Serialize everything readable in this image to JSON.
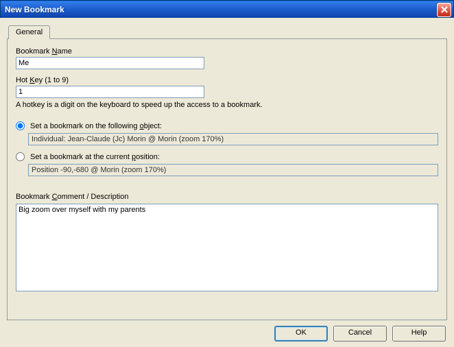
{
  "window": {
    "title": "New Bookmark"
  },
  "tabs": {
    "general": "General"
  },
  "bookmarkName": {
    "label_pre": "Bookmark ",
    "label_u": "N",
    "label_post": "ame",
    "value": "Me"
  },
  "hotKey": {
    "label_pre": "Hot ",
    "label_u": "K",
    "label_post": "ey  (1 to 9)",
    "value": "1",
    "hint": "A hotkey is a digit on the keyboard to speed up the access to a bookmark."
  },
  "radios": {
    "object": {
      "label_pre": "Set a bookmark on the following ",
      "label_u": "o",
      "label_post": "bject:",
      "value": "Individual: Jean-Claude (Jc) Morin @ Morin (zoom 170%)",
      "checked": true
    },
    "position": {
      "label_pre": "Set a bookmark at the current ",
      "label_u": "p",
      "label_post": "osition:",
      "value": "Position -90,-680 @ Morin (zoom 170%)",
      "checked": false
    }
  },
  "comment": {
    "label_pre": "Bookmark ",
    "label_u": "C",
    "label_post": "omment / Description",
    "value": "Big zoom over myself with my parents"
  },
  "buttons": {
    "ok": "OK",
    "cancel": "Cancel",
    "help": "Help"
  }
}
